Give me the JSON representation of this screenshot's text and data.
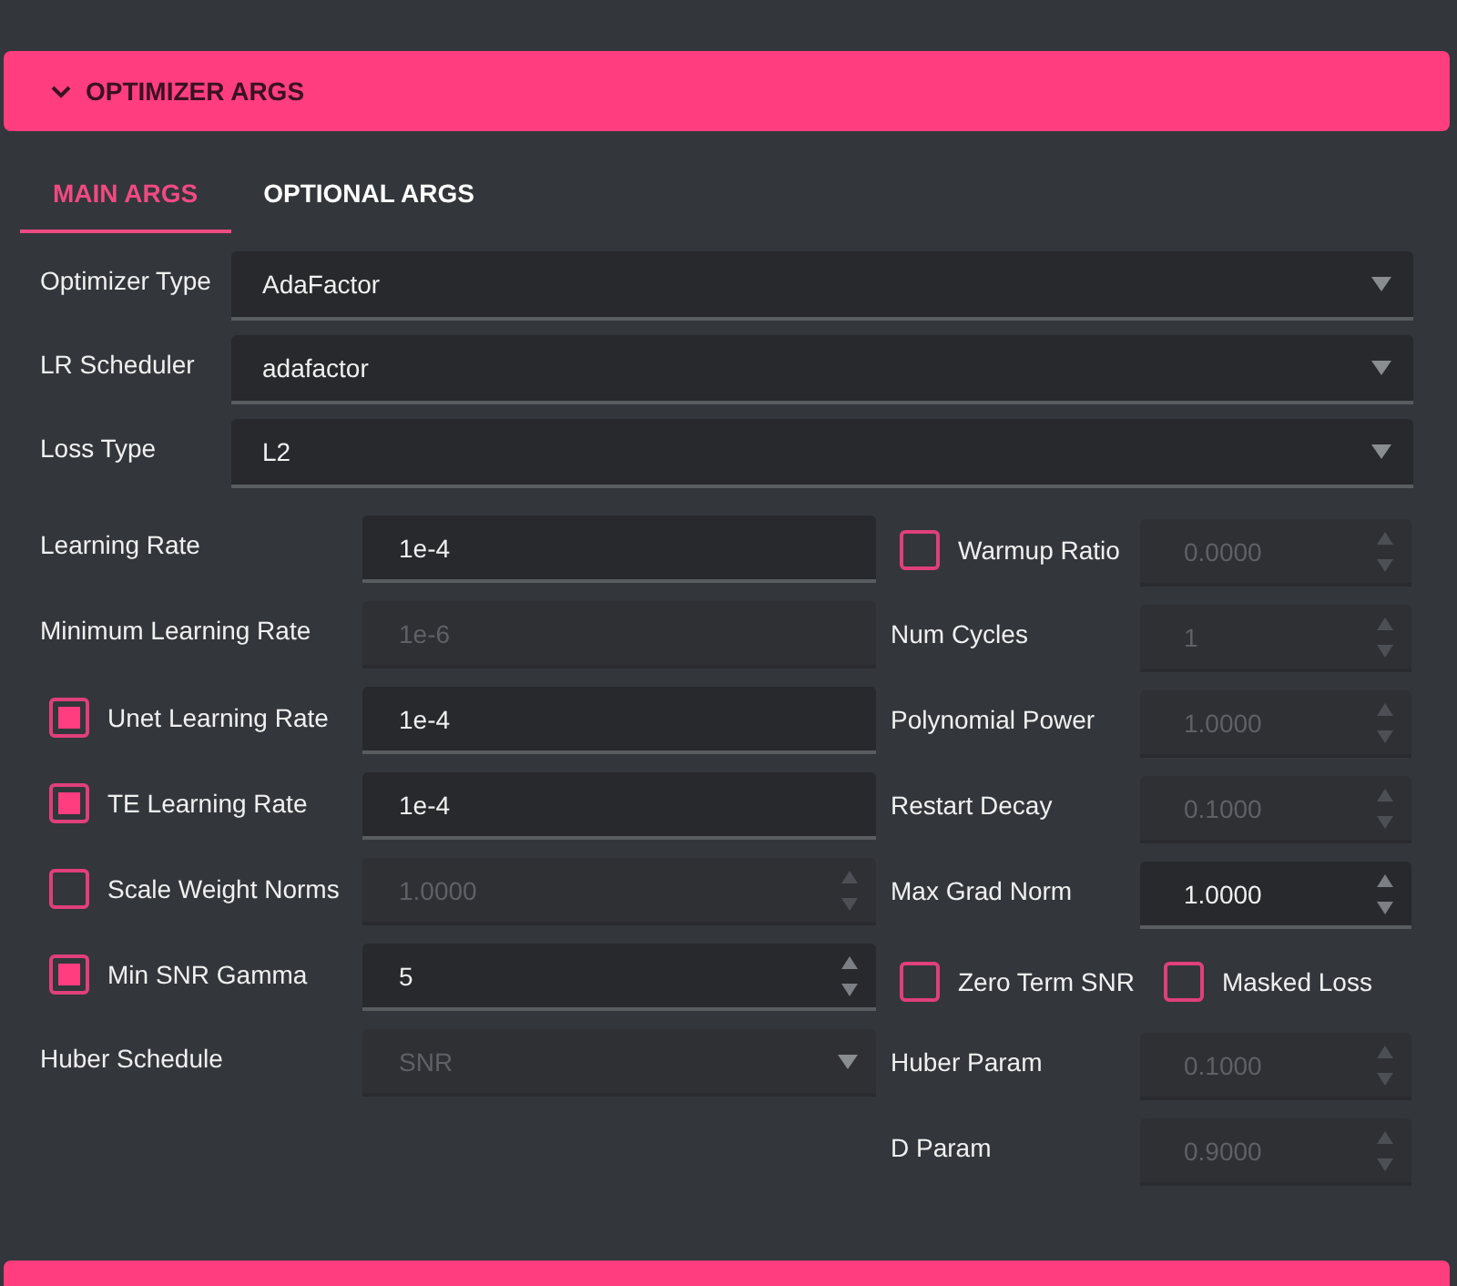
{
  "section": {
    "title": "OPTIMIZER ARGS",
    "expanded": true
  },
  "tabs": [
    {
      "label": "MAIN ARGS",
      "selected": true
    },
    {
      "label": "OPTIONAL ARGS",
      "selected": false
    }
  ],
  "selects": [
    {
      "label": "Optimizer Type",
      "value": "AdaFactor"
    },
    {
      "label": "LR Scheduler",
      "value": "adafactor"
    },
    {
      "label": "Loss Type",
      "value": "L2"
    }
  ],
  "left_fields": [
    {
      "kind": "text",
      "label": "Learning Rate",
      "value": "1e-4",
      "disabled": false
    },
    {
      "kind": "text",
      "label": "Minimum Learning Rate",
      "value": "1e-6",
      "disabled": true
    },
    {
      "kind": "text",
      "label": "Unet Learning Rate",
      "value": "1e-4",
      "disabled": false,
      "checked": true
    },
    {
      "kind": "text",
      "label": "TE Learning Rate",
      "value": "1e-4",
      "disabled": false,
      "checked": true
    },
    {
      "kind": "spinner",
      "label": "Scale Weight Norms",
      "value": "1.0000",
      "disabled": true,
      "checked": false
    },
    {
      "kind": "spinner",
      "label": "Min SNR Gamma",
      "value": "5",
      "disabled": false,
      "checked": true
    },
    {
      "kind": "select",
      "label": "Huber Schedule",
      "value": "SNR",
      "disabled": true
    }
  ],
  "right_fields": [
    {
      "kind": "spinner",
      "label": "Warmup Ratio",
      "value": "0.0000",
      "disabled": true,
      "checked": false
    },
    {
      "kind": "spinner",
      "label": "Num Cycles",
      "value": "1",
      "disabled": true
    },
    {
      "kind": "spinner",
      "label": "Polynomial Power",
      "value": "1.0000",
      "disabled": true
    },
    {
      "kind": "spinner",
      "label": "Restart Decay",
      "value": "0.1000",
      "disabled": true
    },
    {
      "kind": "spinner",
      "label": "Max Grad Norm",
      "value": "1.0000",
      "disabled": false
    },
    {
      "kind": "checks",
      "items": [
        {
          "label": "Zero Term SNR",
          "checked": false
        },
        {
          "label": "Masked Loss",
          "checked": false
        }
      ]
    },
    {
      "kind": "spinner",
      "label": "Huber Param",
      "value": "0.1000",
      "disabled": true
    },
    {
      "kind": "spinner",
      "label": "D Param",
      "value": "0.9000",
      "disabled": true
    }
  ]
}
